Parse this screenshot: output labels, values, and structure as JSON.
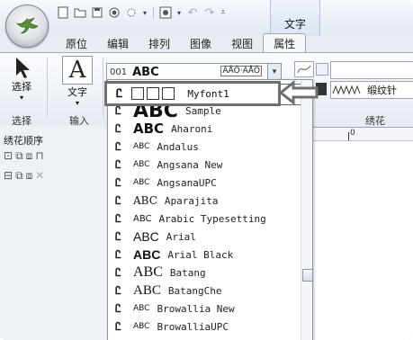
{
  "title_bar": {
    "context_tab_label": "文字"
  },
  "tabs": [
    {
      "label": "原位",
      "active": false
    },
    {
      "label": "编辑",
      "active": false
    },
    {
      "label": "排列",
      "active": false
    },
    {
      "label": "图像",
      "active": false
    },
    {
      "label": "视图",
      "active": false
    },
    {
      "label": "属性",
      "active": true
    }
  ],
  "ribbon": {
    "select_button_label": "选择",
    "select_group_label": "选择",
    "text_button_label": "文字",
    "text_button_glyph": "A",
    "input_group_label": "输入",
    "font_combo": {
      "number": "001",
      "name": "ABC",
      "tag": "ÄÅÖ·ÄÅÖ"
    },
    "stitch_label": "缎纹针",
    "embroidery_group_label": "绣花"
  },
  "panel": {
    "title": "绣花顺序"
  },
  "ruler": {
    "zero_label": "0"
  },
  "callout": {
    "icon": "Ꮭ",
    "label": "Myfont1"
  },
  "dropdown": {
    "items": [
      {
        "icon": "Ꮭ",
        "preview": "ABC",
        "name": "Sample"
      },
      {
        "icon": "Ꮭ",
        "preview": "ABC",
        "name": "Aharoni"
      },
      {
        "icon": "Ꮭ",
        "preview": "ABC",
        "name": "Andalus"
      },
      {
        "icon": "Ꮭ",
        "preview": "ABC",
        "name": "Angsana New"
      },
      {
        "icon": "Ꮭ",
        "preview": "ABC",
        "name": "AngsanaUPC"
      },
      {
        "icon": "Ꮭ",
        "preview": "ABC",
        "name": "Aparajita"
      },
      {
        "icon": "Ꮭ",
        "preview": "ABC",
        "name": "Arabic Typesetting"
      },
      {
        "icon": "Ꮭ",
        "preview": "ABC",
        "name": "Arial"
      },
      {
        "icon": "Ꮭ",
        "preview": "ABC",
        "name": "Arial Black"
      },
      {
        "icon": "Ꮭ",
        "preview": "ABC",
        "name": "Batang"
      },
      {
        "icon": "Ꮭ",
        "preview": "ABC",
        "name": "BatangChe"
      },
      {
        "icon": "Ꮭ",
        "preview": "ABC",
        "name": "Browallia New"
      },
      {
        "icon": "Ꮭ",
        "preview": "ABC",
        "name": "BrowalliaUPC"
      }
    ]
  }
}
